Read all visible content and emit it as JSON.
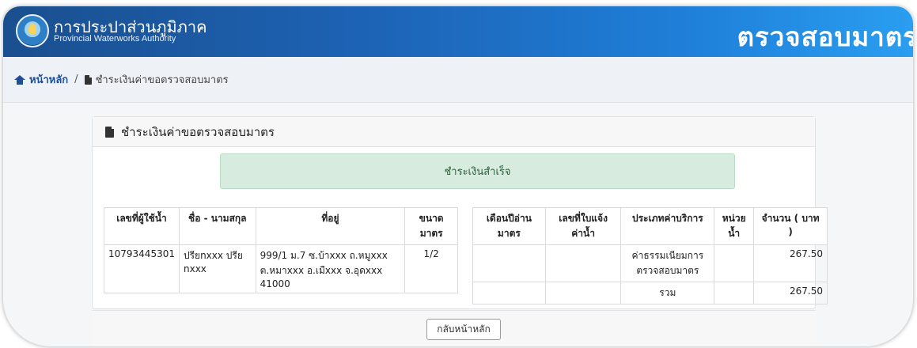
{
  "header": {
    "brand_th": "การประปาส่วนภูมิภาค",
    "brand_en": "Provincial Waterworks Authority",
    "title": "ตรวจสอบมาตร",
    "colors": {
      "header_start": "#1a4f8f",
      "header_end": "#2a9ef0"
    }
  },
  "breadcrumb": {
    "home": "หน้าหลัก",
    "separator": "/",
    "current": "ชำระเงินค่าขอตรวจสอบมาตร"
  },
  "card": {
    "title": "ชำระเงินค่าขอตรวจสอบมาตร",
    "alert": "ชำระเงินสำเร็จ",
    "alert_color": "#d7ecdf"
  },
  "customer_table": {
    "headers": [
      "เลขที่ผู้ใช้น้ำ",
      "ชื่อ - นามสกุล",
      "ที่อยู่",
      "ขนาดมาตร"
    ],
    "row": {
      "account_no": "10793445301",
      "name": "ปรียnxxx ปรีย nxxx",
      "address": "999/1 ม.7 ซ.บ้าxxx ถ.หมูxxx ต.หมาxxx อ.เมืxxx จ.อุดxxx 41000",
      "meter_size": "1/2"
    }
  },
  "billing_table": {
    "headers": [
      "เดือนปีอ่านมาตร",
      "เลขที่ใบแจ้งค่าน้ำ",
      "ประเภทค่าบริการ",
      "หน่วยน้ำ",
      "จำนวน ( บาท )"
    ],
    "rows": [
      {
        "month": "",
        "invoice": "",
        "service": "ค่าธรรมเนียมการตรวจสอบมาตร",
        "units": "",
        "amount": "267.50"
      }
    ],
    "total_label": "รวม",
    "total_amount": "267.50"
  },
  "actions": {
    "back_label": "กลับหน้าหลัก"
  }
}
